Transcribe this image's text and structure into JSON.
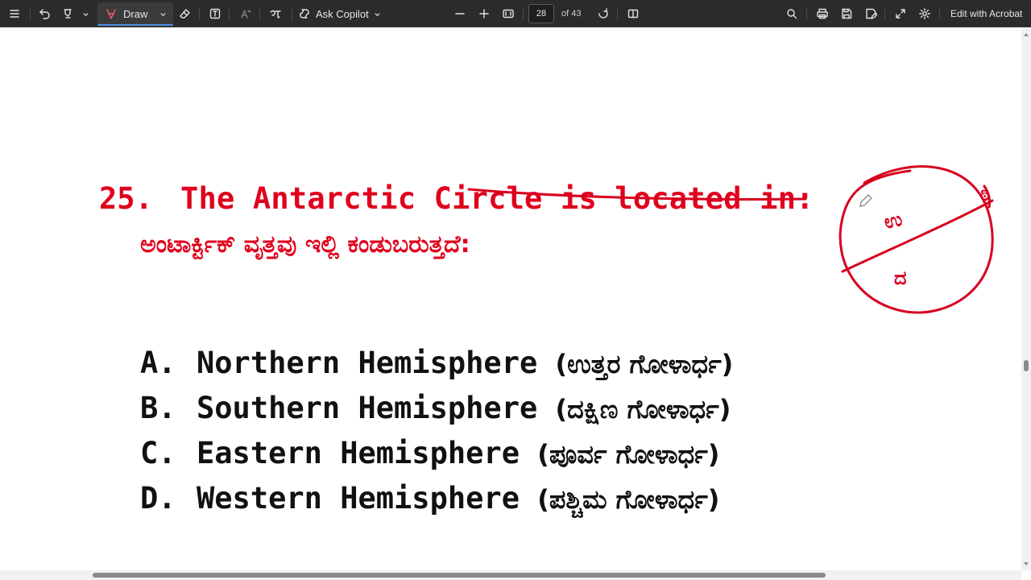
{
  "toolbar": {
    "draw_label": "Draw",
    "copilot_label": "Ask Copilot",
    "page_number": "28",
    "page_total": "of 43",
    "acrobat_label": "Edit with Acrobat",
    "icons": [
      "menu-icon",
      "undo-icon",
      "highlighter-icon",
      "draw-icon",
      "eraser-icon",
      "text-box-icon",
      "read-aloud-icon",
      "translate-icon",
      "copilot-icon",
      "zoom-out-icon",
      "zoom-in-icon",
      "fit-page-icon",
      "rotate-icon",
      "page-view-icon",
      "search-icon",
      "print-icon",
      "save-icon",
      "save-as-icon",
      "fullscreen-icon",
      "settings-icon"
    ]
  },
  "question": {
    "number": "25.",
    "text": "The Antarctic Circle is located in:",
    "kannada": "ಅಂಟಾರ್ಕ್ಟಿಕ್ ವೃತ್ತವು ಇಲ್ಲಿ ಕಂಡುಬರುತ್ತದೆ:"
  },
  "options": [
    {
      "letter": "A.",
      "text": "Northern Hemisphere",
      "kannada": "(ಉತ್ತರ ಗೋಳಾರ್ಧ)"
    },
    {
      "letter": "B.",
      "text": "Southern Hemisphere",
      "kannada": "(ದಕ್ಷಿಣ ಗೋಳಾರ್ಧ)"
    },
    {
      "letter": "C.",
      "text": "Eastern Hemisphere",
      "kannada": "(ಪೂರ್ವ ಗೋಳಾರ್ಧ)"
    },
    {
      "letter": "D.",
      "text": "Western Hemisphere",
      "kannada": "(ಪಶ್ಚಿಮ ಗೋಳಾರ್ಧ)"
    }
  ],
  "annotation": {
    "ink_color": "#d8001f",
    "marks": [
      "ಉ",
      "ದ",
      "ಠಿ"
    ]
  }
}
